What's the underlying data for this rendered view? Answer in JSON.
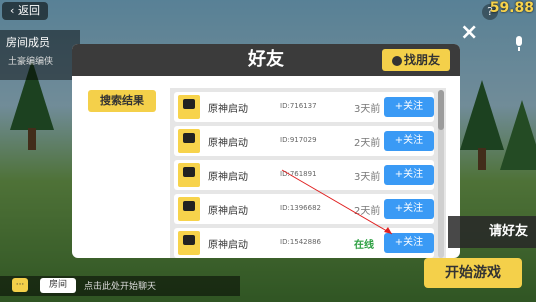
{
  "topbar": {
    "back_label": "返回",
    "timer": "59.88",
    "help": "?"
  },
  "members": {
    "title": "房间成员",
    "member": "土豪编编侠"
  },
  "modal": {
    "title": "好友",
    "find_friends": "找朋友",
    "search_results": "搜索结果",
    "close_icon": "×"
  },
  "friends": [
    {
      "name": "原神启动",
      "id": "ID:716137",
      "status": "3天前",
      "follow": "+关注"
    },
    {
      "name": "原神启动",
      "id": "ID:917029",
      "status": "2天前",
      "follow": "+关注"
    },
    {
      "name": "原神启动",
      "id": "ID:761891",
      "status": "3天前",
      "follow": "+关注"
    },
    {
      "name": "原神启动",
      "id": "ID:1396682",
      "status": "2天前",
      "follow": "+关注"
    },
    {
      "name": "原神启动",
      "id": "ID:1542886",
      "status": "在线",
      "follow": "+关注"
    }
  ],
  "bottom": {
    "invite": "请好友",
    "start": "开始游戏",
    "room_tag": "房间",
    "chat_hint": "点击此处开始聊天"
  },
  "colors": {
    "accent_yellow": "#f4d04a",
    "follow_blue": "#3a9af5",
    "online_green": "#2ea043"
  }
}
